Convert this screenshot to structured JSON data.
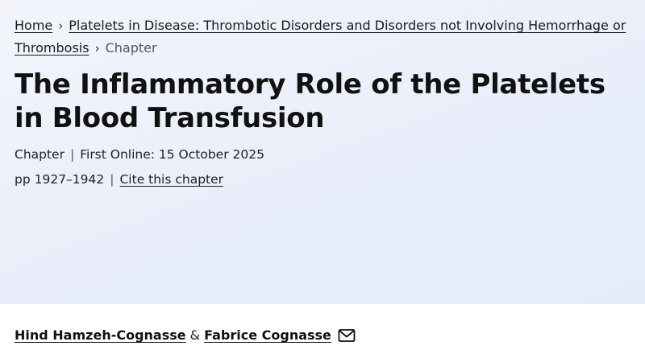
{
  "breadcrumb": {
    "home": "Home",
    "book": "Platelets in Disease: Thrombotic Disorders and Disorders not Involving Hemorrhage or Thrombosis",
    "current": "Chapter"
  },
  "title": "The Inflammatory Role of the Platelets in Blood Transfusion",
  "meta": {
    "type": "Chapter",
    "published": "First Online: 15 October 2025",
    "pages": "pp 1927–1942",
    "cite_link": "Cite this chapter"
  },
  "authors": {
    "author1": "Hind Hamzeh-Cognasse",
    "separator": "&",
    "author2": "Fabrice Cognasse"
  },
  "icons": {
    "breadcrumb_separator": "chevron-right-icon",
    "contact": "envelope-icon"
  },
  "colors": {
    "hero_background": "#e9eefa",
    "text": "#1a1a1a"
  }
}
